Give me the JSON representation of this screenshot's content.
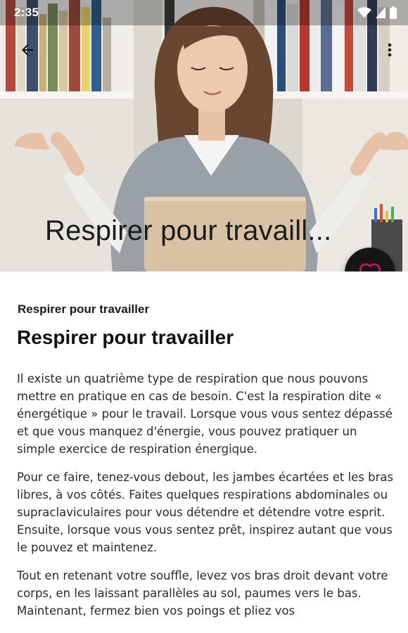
{
  "status_bar": {
    "time": "2:35"
  },
  "app_bar": {
    "back_icon": "arrow-back-icon",
    "menu_icon": "more-vert-icon"
  },
  "hero": {
    "title": "Respirer pour travaill..."
  },
  "fab": {
    "icon": "heart-outline-icon",
    "icon_color": "#c2185b"
  },
  "article": {
    "subtitle": "Respirer pour travailler",
    "headline": "Respirer pour travailler",
    "paragraphs": [
      "Il existe un quatrième type de respiration que nous pouvons mettre en pratique en cas de besoin. C'est la respiration dite « énergétique » pour le travail. Lorsque vous vous sentez dépassé et que vous manquez d'énergie, vous pouvez pratiquer un simple exercice de respiration énergique.",
      "Pour ce faire, tenez-vous debout, les jambes écartées et les bras libres, à vos côtés. Faites quelques respirations abdominales ou supraclaviculaires pour vous détendre et détendre votre esprit. Ensuite, lorsque vous vous sentez prêt, inspirez autant que vous le pouvez et maintenez.",
      "Tout en retenant votre souffle, levez vos bras droit devant votre corps, en les laissant parallèles au sol, paumes vers le bas. Maintenant, fermez bien vos poings et pliez vos"
    ]
  }
}
